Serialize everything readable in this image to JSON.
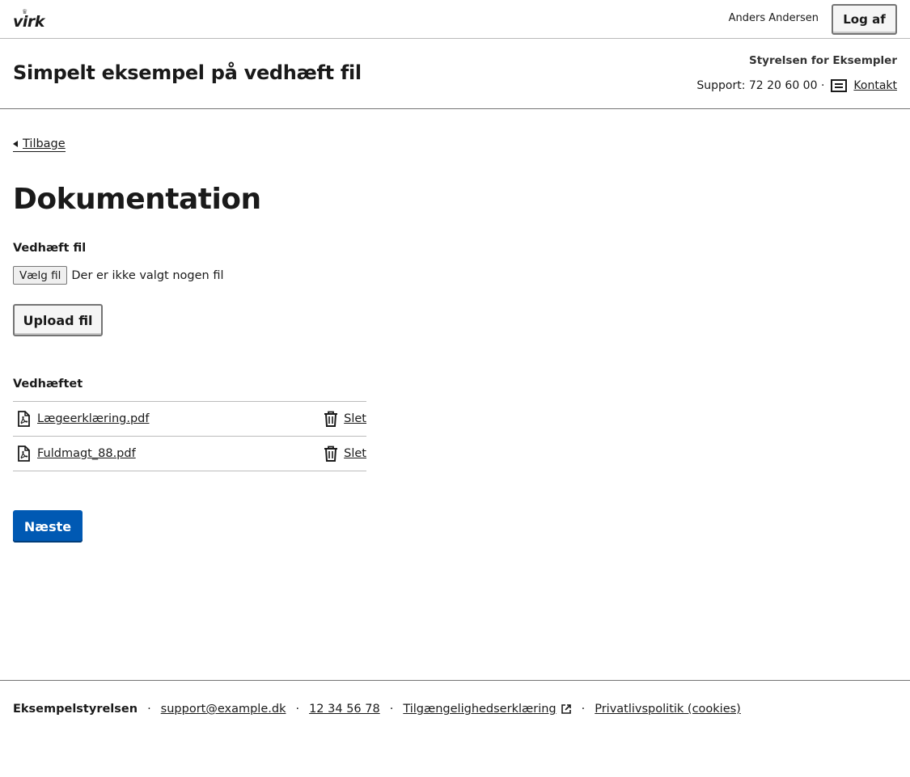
{
  "topbar": {
    "logo_text": "virk",
    "user_name": "Anders Andersen",
    "logout_label": "Log af"
  },
  "header": {
    "title": "Simpelt eksempel på vedhæft fil",
    "authority": "Styrelsen for Eksempler",
    "support_text": "Support: 72 20 60 00 ·",
    "contact_label": "Kontakt",
    "contact_icon": "message-icon"
  },
  "main": {
    "back_label": "Tilbage",
    "heading": "Dokumentation",
    "file_field": {
      "label": "Vedhæft fil",
      "button_label": "Vælg fil",
      "status": "Der er ikke valgt nogen fil"
    },
    "upload_label": "Upload fil",
    "attached_heading": "Vedhæftet",
    "attached_files": [
      {
        "name": "Lægeerklæring.pdf",
        "delete_label": "Slet"
      },
      {
        "name": "Fuldmagt_88.pdf",
        "delete_label": "Slet"
      }
    ],
    "next_label": "Næste"
  },
  "footer": {
    "org": "Eksempelstyrelsen",
    "email": "support@example.dk",
    "phone": "12 34 56 78",
    "accessibility": "Tilgængelighedserklæring",
    "privacy": "Privatlivspolitik (cookies)",
    "separator": "·"
  },
  "colors": {
    "primary": "#0059b3",
    "text": "#1a1a1a",
    "border": "#747474"
  }
}
